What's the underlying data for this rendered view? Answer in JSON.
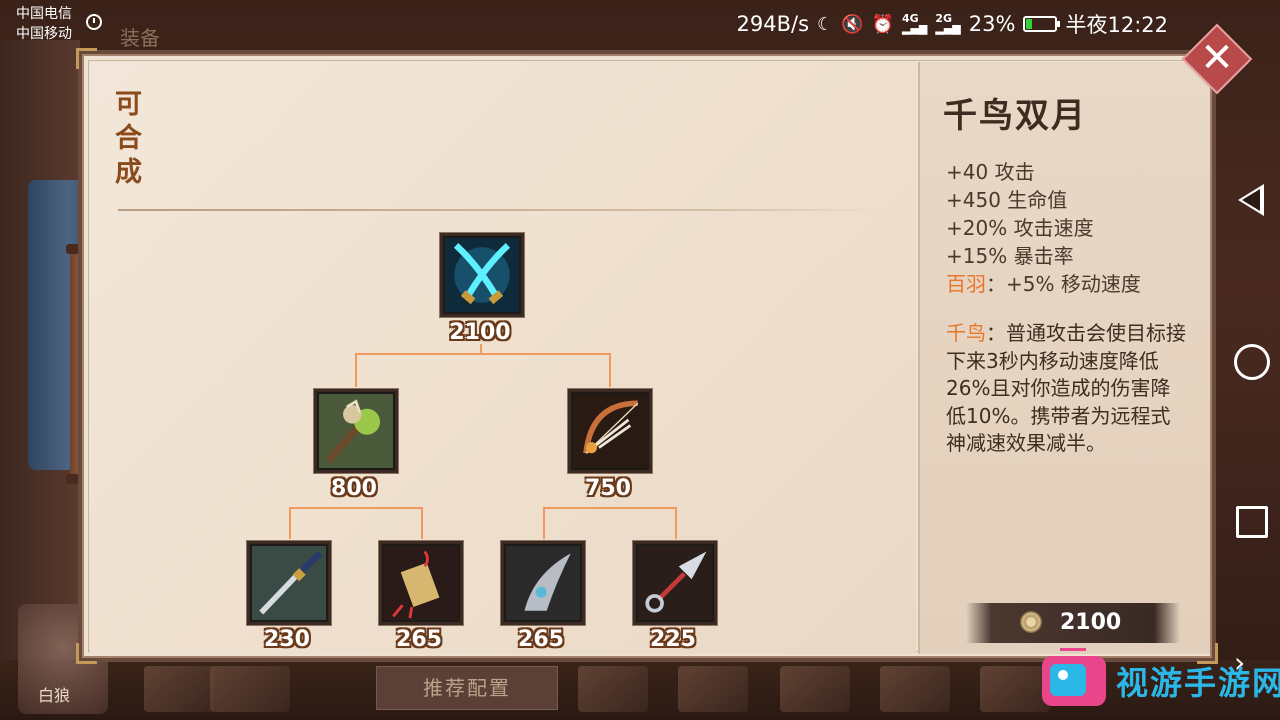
{
  "status_bar": {
    "carrier1": "中国电信",
    "carrier2": "中国移动",
    "speed": "294B/s",
    "net1": "4G",
    "net2": "2G",
    "battery_pct": "23%",
    "battery_level": 0.23,
    "time": "半夜12:22"
  },
  "background": {
    "tab_text": "装备",
    "recommend_button": "推荐配置",
    "character_name": "白狼"
  },
  "panel": {
    "composable_label": "可合成",
    "tree": {
      "root": {
        "name": "千鸟双月",
        "icon": "twin-blades-icon",
        "price": "2100"
      },
      "left": {
        "price": "800",
        "icon": "club-icon"
      },
      "right": {
        "price": "750",
        "icon": "bow-icon"
      },
      "leaves": [
        {
          "price": "230",
          "icon": "katana-icon"
        },
        {
          "price": "265",
          "icon": "charm-icon"
        },
        {
          "price": "265",
          "icon": "claw-icon"
        },
        {
          "price": "225",
          "icon": "kunai-icon"
        }
      ]
    },
    "item": {
      "title": "千鸟双月",
      "stats": [
        "+40 攻击",
        "+450 生命值",
        "+20% 攻击速度",
        "+15% 暴击率"
      ],
      "bonus_label": "百羽",
      "bonus_text": "：+5% 移动速度",
      "passive_label": "千鸟",
      "passive_text": "：普通攻击会使目标接下来3秒内移动速度降低26%且对你造成的伤害降低10%。携带者为远程式神减速效果减半。",
      "total_price": "2100"
    }
  },
  "watermark": {
    "text": "视游手游网"
  },
  "colors": {
    "accent": "#e8752a",
    "panel_bg": "#efe2d2",
    "connector": "#f09a60",
    "close": "#b84a4a"
  }
}
